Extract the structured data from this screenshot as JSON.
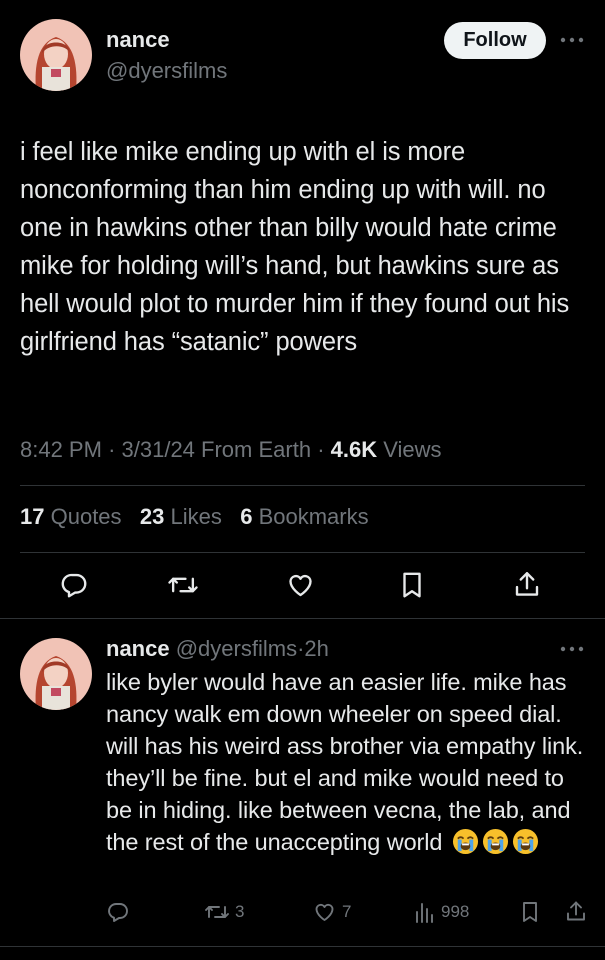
{
  "main_tweet": {
    "display_name": "nance",
    "handle": "@dyersfilms",
    "follow_label": "Follow",
    "text": "i feel like mike ending up with el is more nonconforming than him ending up with will. no one in hawkins other than billy would hate crime mike for holding will’s hand, but hawkins sure as hell would plot to murder him if they found out his girlfriend has “satanic” powers",
    "time": "8:42 PM",
    "date": "3/31/24",
    "source": "From Earth",
    "views_count": "4.6K",
    "views_label": "Views",
    "separator": "·",
    "stats": {
      "quotes_count": "17",
      "quotes_label": "Quotes",
      "likes_count": "23",
      "likes_label": "Likes",
      "bookmarks_count": "6",
      "bookmarks_label": "Bookmarks"
    },
    "actions": [
      "reply-icon",
      "retweet-icon",
      "heart-icon",
      "bookmark-icon",
      "share-icon"
    ]
  },
  "reply": {
    "display_name": "nance",
    "handle": "@dyersfilms",
    "time_ago": "2h",
    "separator": "·",
    "text": "like byler would have an easier life. mike has nancy walk em down wheeler on speed dial. will has his weird ass brother via empathy link. they’ll be fine. but el and mike would need to be in hiding. like between vecna, the lab, and the rest of the unaccepting world",
    "emojis": [
      "loudly-crying-face-emoji",
      "loudly-crying-face-emoji",
      "loudly-crying-face-emoji"
    ],
    "retweets": "3",
    "likes": "7",
    "views": "998"
  },
  "colors": {
    "background": "#000000",
    "text_primary": "#e7e9ea",
    "text_secondary": "#71767b",
    "divider": "#2f3336",
    "follow_bg": "#eff3f4"
  }
}
